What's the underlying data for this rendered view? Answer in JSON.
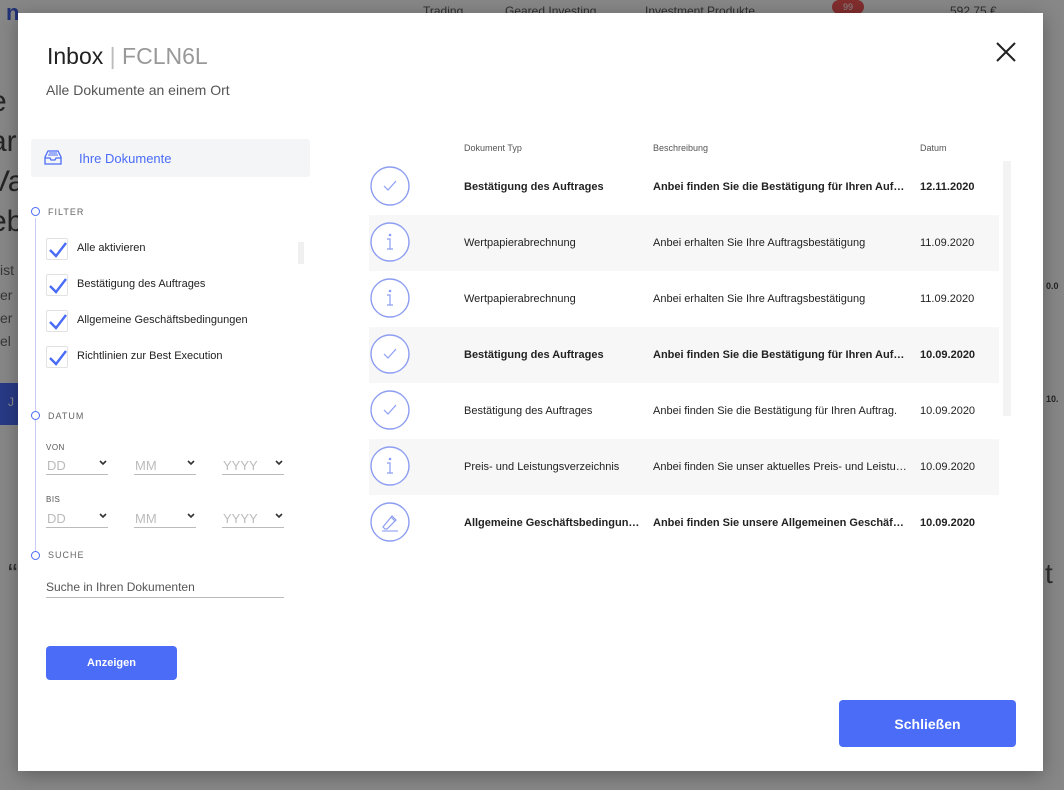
{
  "background": {
    "nav_items": [
      "Trading",
      "Geared Investing",
      "Investment Produkte"
    ],
    "badge_count": "99",
    "balance": "592,75 €",
    "side_values": [
      "0.0",
      "10."
    ]
  },
  "modal": {
    "title": "Inbox",
    "title_separator": "|",
    "account_code": "FCLN6L",
    "subtitle": "Alle Dokumente an einem Ort",
    "close_icon": "close-icon"
  },
  "sidebar": {
    "docs_tab_label": "Ihre Dokumente",
    "filter": {
      "label": "FILTER",
      "items": [
        {
          "label": "Alle aktivieren",
          "checked": true
        },
        {
          "label": "Bestätigung des Auftrages",
          "checked": true
        },
        {
          "label": "Allgemeine Geschäftsbedingungen",
          "checked": true
        },
        {
          "label": "Richtlinien zur Best Execution",
          "checked": true
        }
      ]
    },
    "date": {
      "label": "DATUM",
      "from_label": "VON",
      "to_label": "BIS",
      "day_placeholder": "DD",
      "month_placeholder": "MM",
      "year_placeholder": "YYYY"
    },
    "search": {
      "label": "SUCHE",
      "placeholder": "Suche in Ihren Dokumenten"
    },
    "show_button": "Anzeigen"
  },
  "table": {
    "headers": {
      "type": "Dokument Typ",
      "description": "Beschreibung",
      "date": "Datum"
    },
    "rows": [
      {
        "icon": "check",
        "type": "Bestätigung des Auftrages",
        "description": "Anbei finden Sie die Bestätigung für Ihren Auftrag.",
        "date": "12.11.2020",
        "unread": true
      },
      {
        "icon": "info",
        "type": "Wertpapierabrechnung",
        "description": "Anbei erhalten Sie Ihre Auftragsbestätigung",
        "date": "11.09.2020",
        "unread": false
      },
      {
        "icon": "info",
        "type": "Wertpapierabrechnung",
        "description": "Anbei erhalten Sie Ihre Auftragsbestätigung",
        "date": "11.09.2020",
        "unread": false
      },
      {
        "icon": "check",
        "type": "Bestätigung des Auftrages",
        "description": "Anbei finden Sie die Bestätigung für Ihren Auftrag.",
        "date": "10.09.2020",
        "unread": true
      },
      {
        "icon": "check",
        "type": "Bestätigung des Auftrages",
        "description": "Anbei finden Sie die Bestätigung für Ihren Auftrag.",
        "date": "10.09.2020",
        "unread": false
      },
      {
        "icon": "info",
        "type": "Preis- und Leistungsverzeichnis",
        "description": "Anbei finden Sie unser aktuelles Preis- und Leistungsverzeichnis",
        "date": "10.09.2020",
        "unread": false
      },
      {
        "icon": "sign",
        "type": "Allgemeine Geschäftsbedingungen",
        "description": "Anbei finden Sie unsere Allgemeinen Geschäftsbedingungen",
        "date": "10.09.2020",
        "unread": true
      }
    ]
  },
  "footer": {
    "close_button": "Schließen"
  },
  "colors": {
    "accent": "#4a6cf7",
    "icon_stroke": "#8c9df2"
  }
}
